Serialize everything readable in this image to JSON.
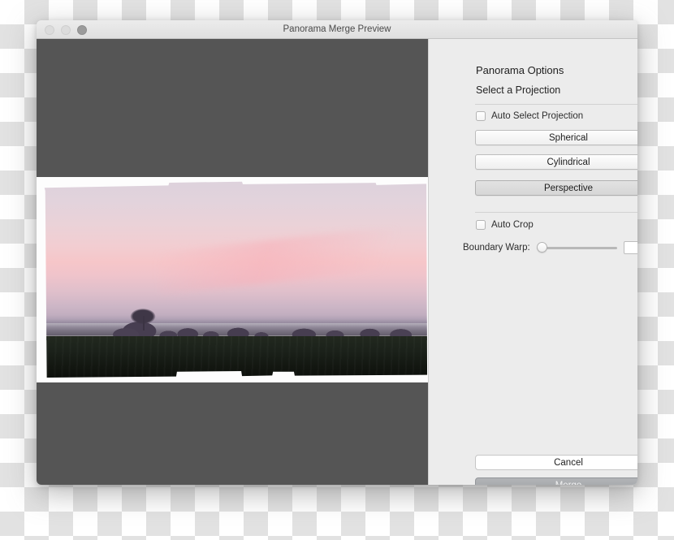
{
  "window": {
    "title": "Panorama Merge Preview",
    "traffic_lights": [
      "close-button",
      "minimize-button",
      "zoom-button"
    ]
  },
  "preview": {
    "name": "panorama-preview-canvas",
    "background_color": "#555555",
    "description": "Stitched sunset panorama with irregular edges over dark gray canvas"
  },
  "panel": {
    "heading": "Panorama Options",
    "subheading": "Select a Projection",
    "auto_select": {
      "label": "Auto Select Projection",
      "checked": false
    },
    "projections": [
      {
        "label": "Spherical",
        "selected": false
      },
      {
        "label": "Cylindrical",
        "selected": false
      },
      {
        "label": "Perspective",
        "selected": true
      }
    ],
    "auto_crop": {
      "label": "Auto Crop",
      "checked": false
    },
    "boundary_warp": {
      "label": "Boundary Warp:",
      "value": "0",
      "min": 0,
      "max": 100
    },
    "actions": {
      "cancel_label": "Cancel",
      "merge_label": "Merge"
    }
  }
}
